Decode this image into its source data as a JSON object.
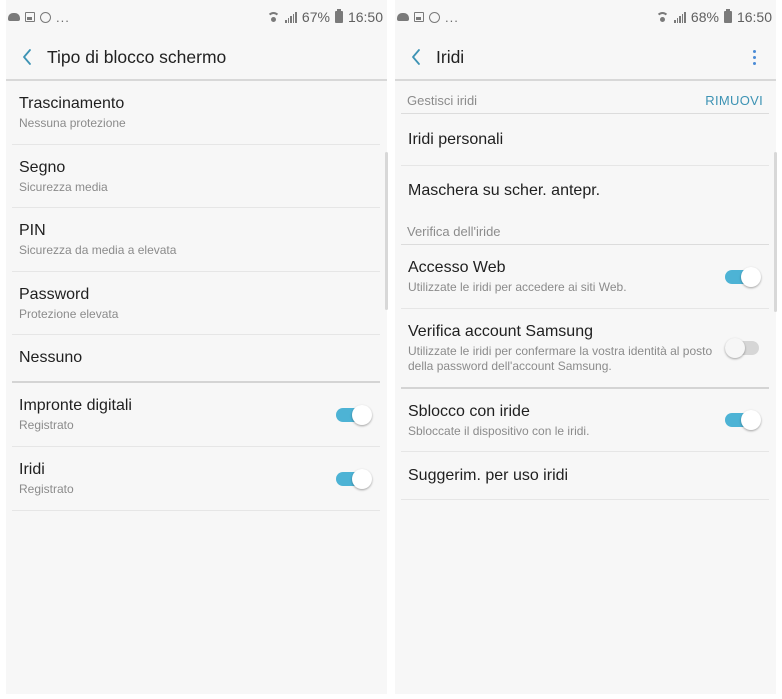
{
  "left": {
    "status": {
      "battery": "67%",
      "time": "16:50",
      "more": "..."
    },
    "title": "Tipo di blocco schermo",
    "items": [
      {
        "title": "Trascinamento",
        "subtitle": "Nessuna protezione"
      },
      {
        "title": "Segno",
        "subtitle": "Sicurezza media"
      },
      {
        "title": "PIN",
        "subtitle": "Sicurezza da media a elevata"
      },
      {
        "title": "Password",
        "subtitle": "Protezione elevata"
      },
      {
        "title": "Nessuno"
      },
      {
        "title": "Impronte digitali",
        "subtitle": "Registrato",
        "toggle": true
      },
      {
        "title": "Iridi",
        "subtitle": "Registrato",
        "toggle": true
      }
    ]
  },
  "right": {
    "status": {
      "battery": "68%",
      "time": "16:50",
      "more": "..."
    },
    "title": "Iridi",
    "manage_header": "Gestisci iridi",
    "remove_label": "RIMUOVI",
    "personal_irises": "Iridi personali",
    "preview_mask": "Maschera su scher. antepr.",
    "verify_header": "Verifica dell'iride",
    "web_access": {
      "title": "Accesso Web",
      "subtitle": "Utilizzate le iridi per accedere ai siti Web.",
      "toggle": true
    },
    "samsung_account": {
      "title": "Verifica account Samsung",
      "subtitle": "Utilizzate le iridi per confermare la vostra identità al posto della password dell'account Samsung.",
      "toggle": false
    },
    "iris_unlock": {
      "title": "Sblocco con iride",
      "subtitle": "Sbloccate il dispositivo con le iridi.",
      "toggle": true
    },
    "tips": "Suggerim. per uso iridi"
  },
  "colors": {
    "accent": "#4db3d5",
    "action": "#3d93b4",
    "background": "#f7f7f7"
  }
}
